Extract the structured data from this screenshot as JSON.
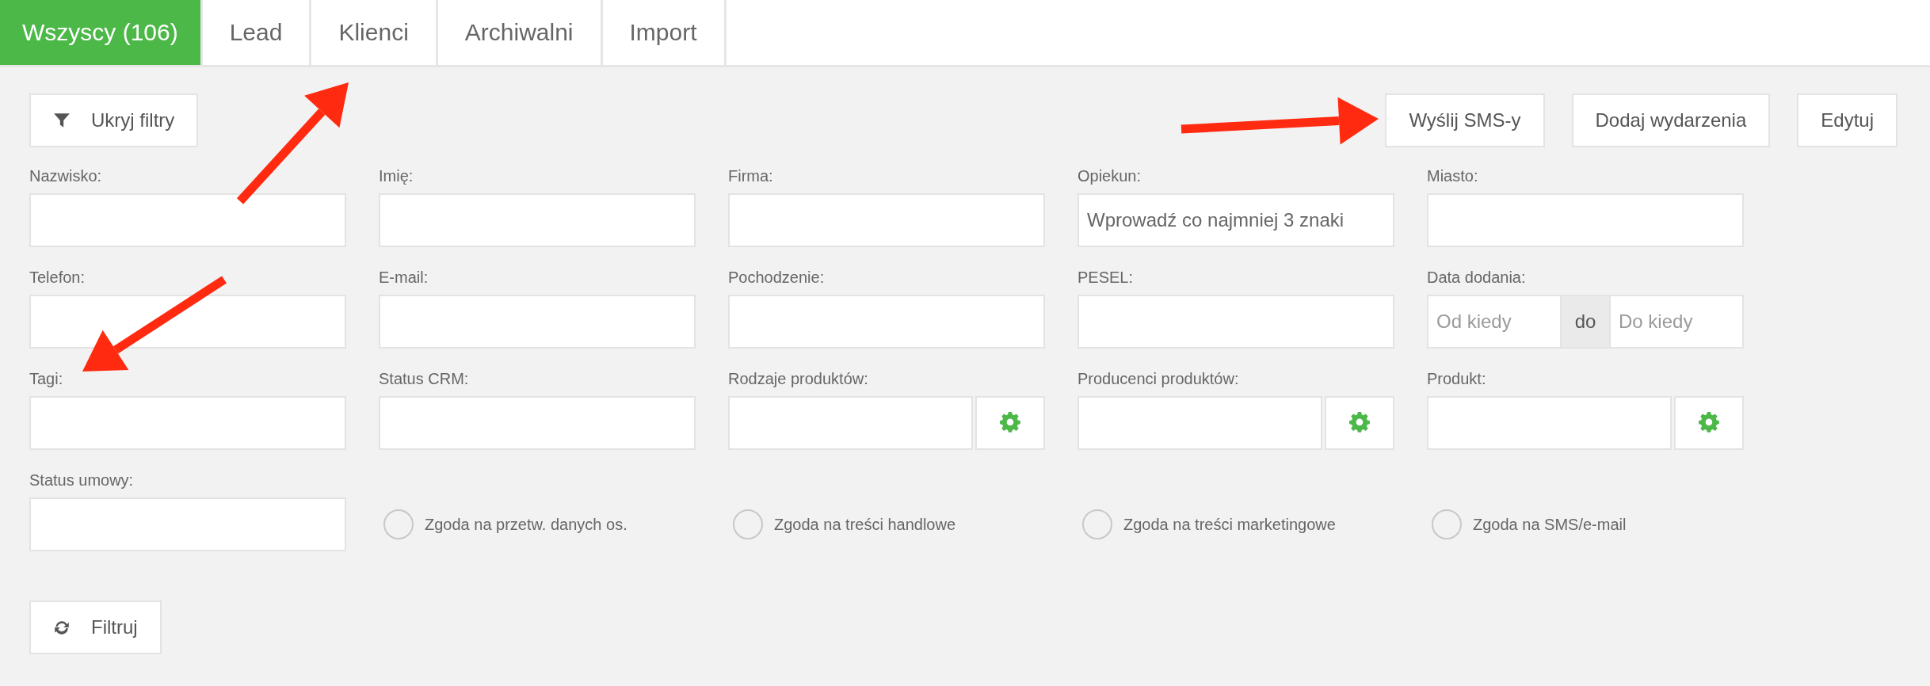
{
  "tabs": [
    {
      "label": "Wszyscy (106)",
      "selected": true
    },
    {
      "label": "Lead",
      "selected": false
    },
    {
      "label": "Klienci",
      "selected": false
    },
    {
      "label": "Archiwalni",
      "selected": false
    },
    {
      "label": "Import",
      "selected": false
    }
  ],
  "filter_toggle": {
    "label": "Ukryj filtry"
  },
  "actions": [
    "Wyślij SMS-y",
    "Dodaj wydarzenia",
    "Edytuj"
  ],
  "fields": [
    {
      "label": "Nazwisko:",
      "kind": "text"
    },
    {
      "label": "Imię:",
      "kind": "text"
    },
    {
      "label": "Firma:",
      "kind": "text"
    },
    {
      "label": "Opiekun:",
      "kind": "select",
      "placeholder": "Wprowadź co najmniej 3 znaki"
    },
    {
      "label": "Miasto:",
      "kind": "text"
    },
    {
      "label": "Telefon:",
      "kind": "text"
    },
    {
      "label": "E-mail:",
      "kind": "text"
    },
    {
      "label": "Pochodzenie:",
      "kind": "text"
    },
    {
      "label": "PESEL:",
      "kind": "text"
    },
    {
      "label": "Data dodania:",
      "kind": "daterange",
      "from_placeholder": "Od kiedy",
      "separator": "do",
      "to_placeholder": "Do kiedy"
    },
    {
      "label": "Tagi:",
      "kind": "text"
    },
    {
      "label": "Status CRM:",
      "kind": "text"
    },
    {
      "label": "Rodzaje produktów:",
      "kind": "picker"
    },
    {
      "label": "Producenci produktów:",
      "kind": "picker"
    },
    {
      "label": "Produkt:",
      "kind": "picker"
    },
    {
      "label": "Status umowy:",
      "kind": "text"
    }
  ],
  "consents": [
    {
      "label": "Zgoda na przetw. danych os.",
      "checked": false
    },
    {
      "label": "Zgoda na treści handlowe",
      "checked": false
    },
    {
      "label": "Zgoda na treści marketingowe",
      "checked": false
    },
    {
      "label": "Zgoda na SMS/e-mail",
      "checked": false
    }
  ],
  "filter_button": {
    "label": "Filtruj"
  }
}
